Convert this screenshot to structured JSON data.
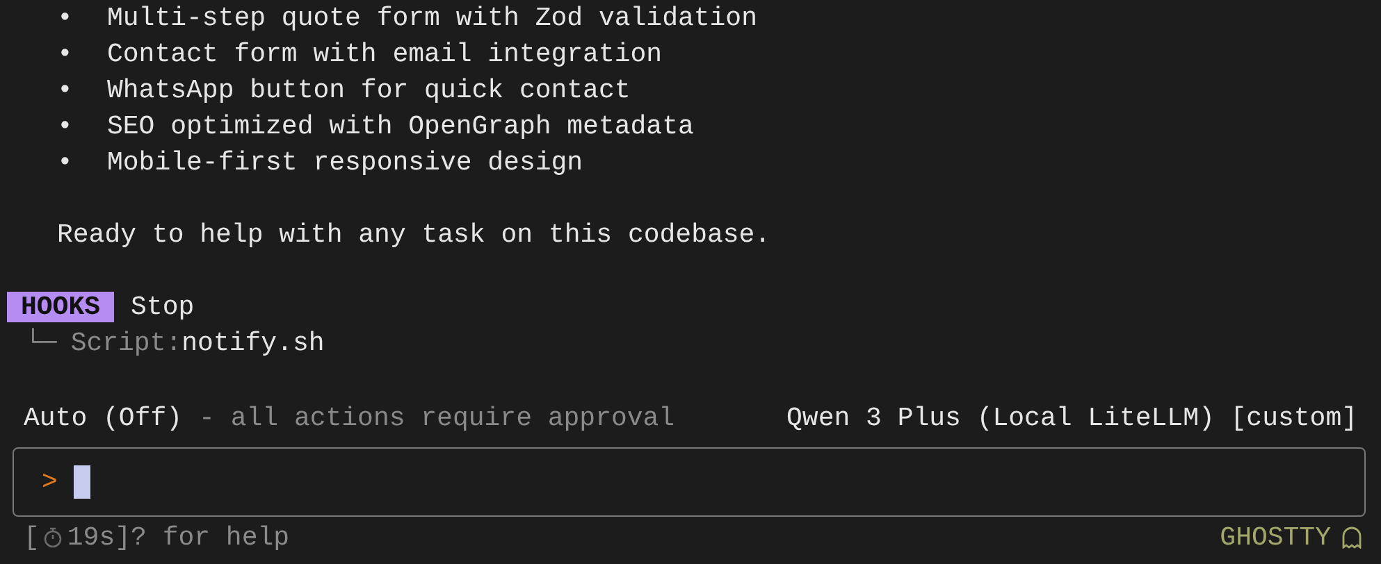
{
  "features": [
    {
      "bullet": "•",
      "text": "Multi-step quote form with Zod validation"
    },
    {
      "bullet": "•",
      "text": "Contact form with email integration"
    },
    {
      "bullet": "•",
      "text": "WhatsApp button for quick contact"
    },
    {
      "bullet": "•",
      "text": "SEO optimized with OpenGraph metadata"
    },
    {
      "bullet": "•",
      "text": "Mobile-first responsive design"
    }
  ],
  "message": "Ready to help with any task on this codebase.",
  "hook": {
    "badge": "HOOKS",
    "event": "Stop",
    "tree": "└─",
    "script_label": "Script:",
    "script": "notify.sh"
  },
  "status": {
    "mode": "Auto (Off)",
    "mode_note": "- all actions require approval",
    "model": "Qwen 3 Plus (Local LiteLLM) [custom]"
  },
  "prompt": {
    "symbol": ">"
  },
  "footer": {
    "open": "[",
    "timer": "19s]? for help",
    "app": "GHOSTTY"
  }
}
